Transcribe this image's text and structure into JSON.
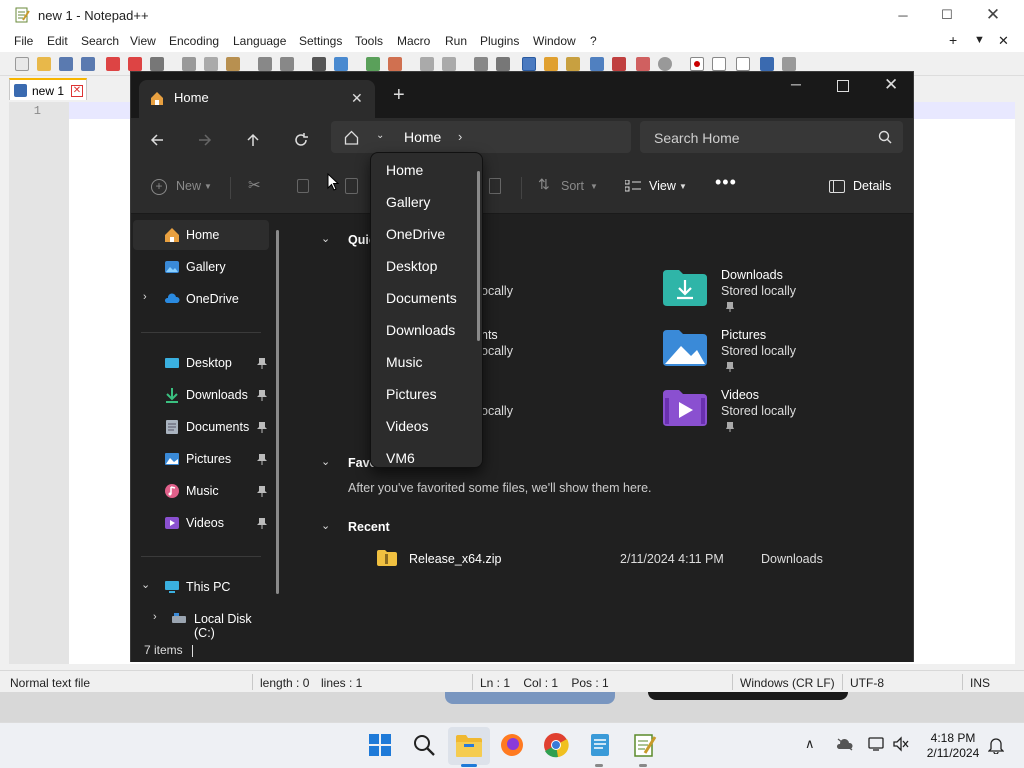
{
  "notepad": {
    "title": "new 1 - Notepad++",
    "menu": [
      "File",
      "Edit",
      "Search",
      "View",
      "Encoding",
      "Language",
      "Settings",
      "Tools",
      "Macro",
      "Run",
      "Plugins",
      "Window",
      "?"
    ],
    "tab_label": "new 1",
    "line_number": "1",
    "status": {
      "file_type": "Normal text file",
      "length": "length : 0",
      "lines": "lines : 1",
      "cursor": "Ln : 1    Col : 1    Pos : 1",
      "eol": "Windows (CR LF)",
      "encoding": "UTF-8",
      "mode": "INS"
    }
  },
  "explorer": {
    "tab_title": "Home",
    "breadcrumb": "Home",
    "search_placeholder": "Search Home",
    "commands": {
      "new": "New",
      "sort": "Sort",
      "view": "View",
      "details": "Details"
    },
    "sidebar": [
      {
        "label": "Home",
        "icon": "home-icon"
      },
      {
        "label": "Gallery",
        "icon": "gallery-icon"
      },
      {
        "label": "OneDrive",
        "icon": "cloud-icon"
      },
      {
        "label": "Desktop",
        "icon": "desktop-icon"
      },
      {
        "label": "Downloads",
        "icon": "download-icon"
      },
      {
        "label": "Documents",
        "icon": "document-icon"
      },
      {
        "label": "Pictures",
        "icon": "picture-icon"
      },
      {
        "label": "Music",
        "icon": "music-icon"
      },
      {
        "label": "Videos",
        "icon": "video-icon"
      },
      {
        "label": "This PC",
        "icon": "pc-icon"
      },
      {
        "label": "Local Disk (C:)",
        "icon": "disk-icon"
      }
    ],
    "sections": {
      "quick_access": "Quic",
      "favorites": "Favor",
      "favorites_empty": "After you've favorited some files, we'll show them here.",
      "recent": "Recent"
    },
    "quick_access_partial": [
      "ocally",
      "nts",
      "ocally",
      "ocally"
    ],
    "quick_access_folders": [
      {
        "name": "Downloads",
        "sub": "Stored locally",
        "icon": "downloads-folder-icon"
      },
      {
        "name": "Pictures",
        "sub": "Stored locally",
        "icon": "pictures-folder-icon"
      },
      {
        "name": "Videos",
        "sub": "Stored locally",
        "icon": "videos-folder-icon"
      }
    ],
    "recent_files": [
      {
        "name": "Release_x64.zip",
        "date": "2/11/2024 4:11 PM",
        "location": "Downloads"
      }
    ],
    "item_count": "7 items",
    "dropdown": [
      "Home",
      "Gallery",
      "OneDrive",
      "Desktop",
      "Documents",
      "Downloads",
      "Music",
      "Pictures",
      "Videos",
      "VM6"
    ]
  },
  "taskbar": {
    "time": "4:18 PM",
    "date": "2/11/2024"
  },
  "colors": {
    "explorer_bg": "#202020",
    "accent_blue": "#4cc2ff",
    "folder_teal": "#2fb5a8"
  }
}
